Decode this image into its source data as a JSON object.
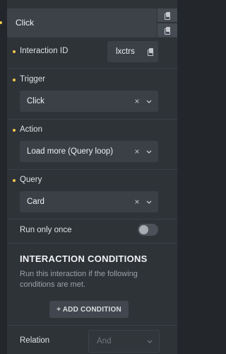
{
  "interaction": {
    "title": "Click",
    "id_label": "Interaction ID",
    "id_value": "lxctrs",
    "trigger": {
      "label": "Trigger",
      "value": "Click"
    },
    "action": {
      "label": "Action",
      "value": "Load more (Query loop)"
    },
    "query": {
      "label": "Query",
      "value": "Card"
    },
    "run_once": {
      "label": "Run only once",
      "enabled": false
    }
  },
  "conditions": {
    "title": "INTERACTION CONDITIONS",
    "description": "Run this interaction if the following conditions are met.",
    "add_button": "+ ADD CONDITION"
  },
  "relation": {
    "label": "Relation",
    "placeholder": "And"
  },
  "icons": {
    "copy": "copy-icon",
    "clear": "×",
    "dropdown": "chevron-down-icon"
  },
  "colors": {
    "accent_dot": "#f2c94c",
    "panel_bg": "#2e3338",
    "field_bg": "#3a4046"
  }
}
